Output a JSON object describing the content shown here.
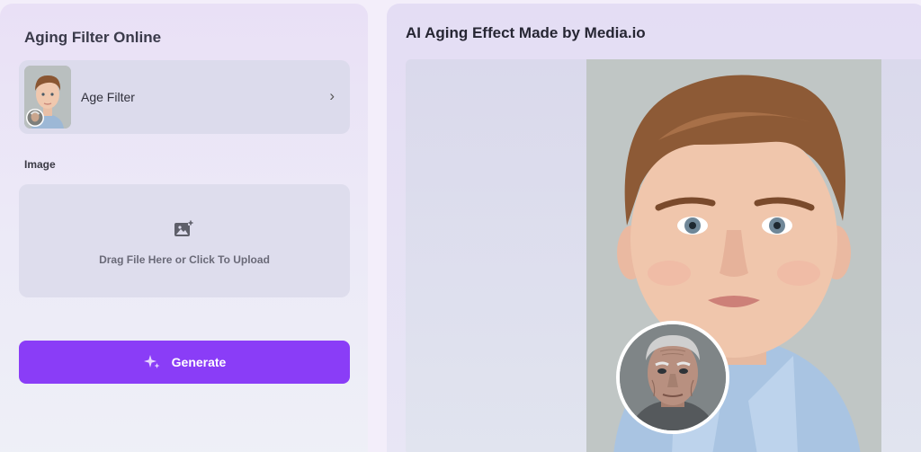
{
  "left_panel": {
    "title": "Aging Filter Online",
    "filter": {
      "label": "Age Filter",
      "chevron": "›"
    },
    "image_label": "Image",
    "upload": {
      "text": "Drag File Here or Click To Upload",
      "icon": "image-upload-icon"
    },
    "generate": {
      "label": "Generate",
      "icon": "sparkle-icon"
    }
  },
  "right_panel": {
    "title": "AI Aging Effect Made by Media.io"
  },
  "colors": {
    "accent": "#8a3df7",
    "panel_bg": "#ece8f7",
    "card_bg": "#dcdbec"
  }
}
